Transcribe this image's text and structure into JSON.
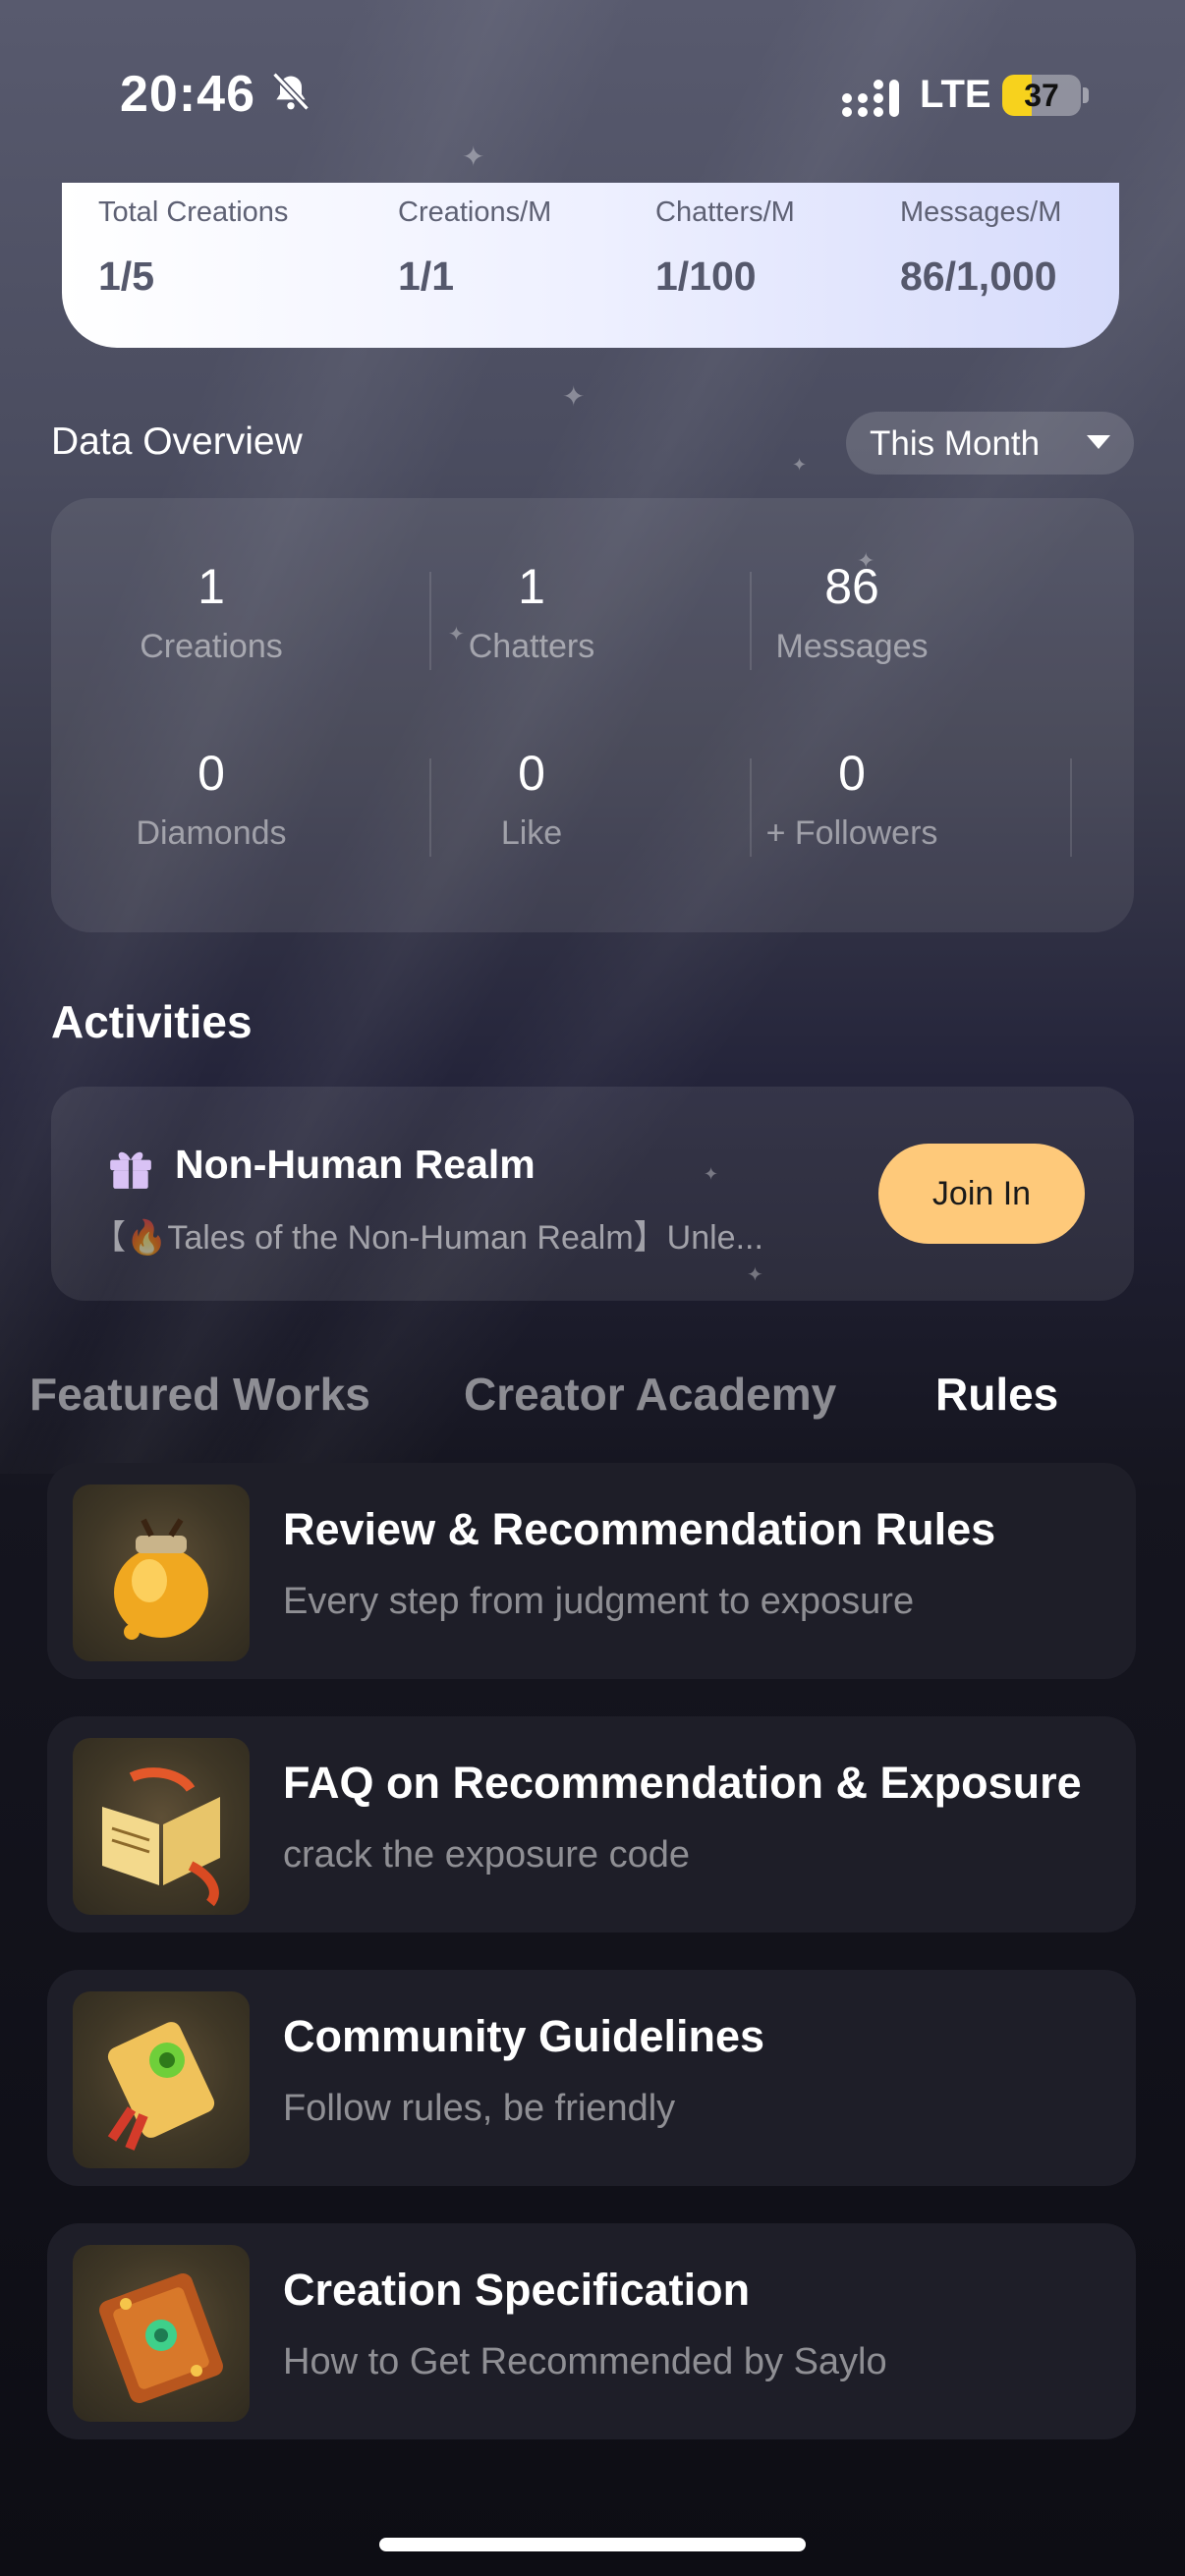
{
  "status_bar": {
    "time": "20:46",
    "network": "LTE",
    "battery": "37",
    "battery_level": 0.37
  },
  "quota": [
    {
      "label": "Total Creations",
      "value": "1/5"
    },
    {
      "label": "Creations/M",
      "value": "1/1"
    },
    {
      "label": "Chatters/M",
      "value": "1/100"
    },
    {
      "label": "Messages/M",
      "value": "86/1,000"
    }
  ],
  "overview": {
    "title": "Data Overview",
    "period": "This Month",
    "stats": [
      {
        "value": "1",
        "label": "Creations"
      },
      {
        "value": "1",
        "label": "Chatters"
      },
      {
        "value": "86",
        "label": "Messages"
      },
      {
        "value": "0",
        "label": "Diamonds"
      },
      {
        "value": "0",
        "label": "Like"
      },
      {
        "value": "0",
        "label": "+ Followers"
      }
    ]
  },
  "activities": {
    "title": "Activities",
    "item": {
      "name": "Non-Human Realm",
      "description": "【🔥Tales of the Non-Human Realm】Unle...",
      "button": "Join In"
    }
  },
  "tabs": [
    "Featured Works",
    "Creator Academy",
    "Rules"
  ],
  "active_tab": "Rules",
  "rules": [
    {
      "title": "Review & Recommendation Rules",
      "subtitle": "Every step from judgment to exposure",
      "icon": "honey-jar-icon"
    },
    {
      "title": "FAQ on Recommendation & Exposure",
      "subtitle": "crack the exposure code",
      "icon": "open-book-icon"
    },
    {
      "title": "Community Guidelines",
      "subtitle": "Follow rules, be friendly",
      "icon": "scroll-icon"
    },
    {
      "title": "Creation Specification",
      "subtitle": "How to Get Recommended by Saylo",
      "icon": "spellbook-icon"
    }
  ],
  "colors": {
    "join_button": "#fec97a",
    "battery": "#f7d21d",
    "card": "#1e1e28"
  }
}
